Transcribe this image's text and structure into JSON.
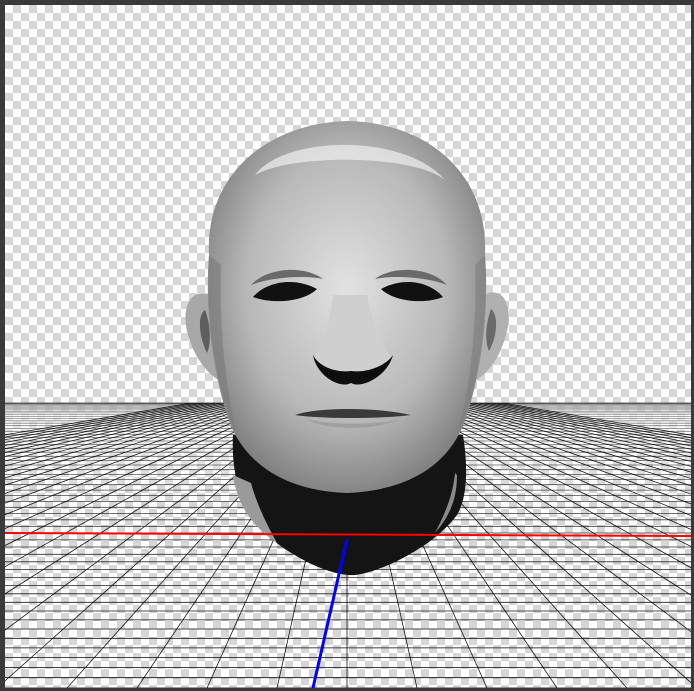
{
  "viewport": {
    "background": "transparency-checkerboard",
    "grid_color": "#000000",
    "x_axis_color": "#ff0000",
    "z_axis_color": "#0000ff"
  },
  "model": {
    "type": "human-head-sculpt",
    "material_color": "#c8c8c8"
  }
}
